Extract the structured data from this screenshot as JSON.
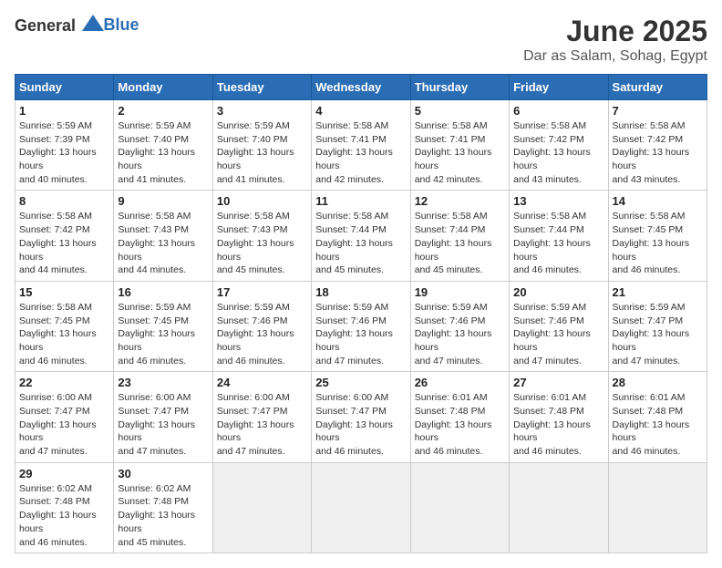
{
  "header": {
    "logo_general": "General",
    "logo_blue": "Blue",
    "month": "June 2025",
    "location": "Dar as Salam, Sohag, Egypt"
  },
  "weekdays": [
    "Sunday",
    "Monday",
    "Tuesday",
    "Wednesday",
    "Thursday",
    "Friday",
    "Saturday"
  ],
  "weeks": [
    [
      {
        "day": 1,
        "sunrise": "5:59 AM",
        "sunset": "7:39 PM",
        "daylight": "13 hours and 40 minutes"
      },
      {
        "day": 2,
        "sunrise": "5:59 AM",
        "sunset": "7:40 PM",
        "daylight": "13 hours and 41 minutes"
      },
      {
        "day": 3,
        "sunrise": "5:59 AM",
        "sunset": "7:40 PM",
        "daylight": "13 hours and 41 minutes"
      },
      {
        "day": 4,
        "sunrise": "5:58 AM",
        "sunset": "7:41 PM",
        "daylight": "13 hours and 42 minutes"
      },
      {
        "day": 5,
        "sunrise": "5:58 AM",
        "sunset": "7:41 PM",
        "daylight": "13 hours and 42 minutes"
      },
      {
        "day": 6,
        "sunrise": "5:58 AM",
        "sunset": "7:42 PM",
        "daylight": "13 hours and 43 minutes"
      },
      {
        "day": 7,
        "sunrise": "5:58 AM",
        "sunset": "7:42 PM",
        "daylight": "13 hours and 43 minutes"
      }
    ],
    [
      {
        "day": 8,
        "sunrise": "5:58 AM",
        "sunset": "7:42 PM",
        "daylight": "13 hours and 44 minutes"
      },
      {
        "day": 9,
        "sunrise": "5:58 AM",
        "sunset": "7:43 PM",
        "daylight": "13 hours and 44 minutes"
      },
      {
        "day": 10,
        "sunrise": "5:58 AM",
        "sunset": "7:43 PM",
        "daylight": "13 hours and 45 minutes"
      },
      {
        "day": 11,
        "sunrise": "5:58 AM",
        "sunset": "7:44 PM",
        "daylight": "13 hours and 45 minutes"
      },
      {
        "day": 12,
        "sunrise": "5:58 AM",
        "sunset": "7:44 PM",
        "daylight": "13 hours and 45 minutes"
      },
      {
        "day": 13,
        "sunrise": "5:58 AM",
        "sunset": "7:44 PM",
        "daylight": "13 hours and 46 minutes"
      },
      {
        "day": 14,
        "sunrise": "5:58 AM",
        "sunset": "7:45 PM",
        "daylight": "13 hours and 46 minutes"
      }
    ],
    [
      {
        "day": 15,
        "sunrise": "5:58 AM",
        "sunset": "7:45 PM",
        "daylight": "13 hours and 46 minutes"
      },
      {
        "day": 16,
        "sunrise": "5:59 AM",
        "sunset": "7:45 PM",
        "daylight": "13 hours and 46 minutes"
      },
      {
        "day": 17,
        "sunrise": "5:59 AM",
        "sunset": "7:46 PM",
        "daylight": "13 hours and 46 minutes"
      },
      {
        "day": 18,
        "sunrise": "5:59 AM",
        "sunset": "7:46 PM",
        "daylight": "13 hours and 47 minutes"
      },
      {
        "day": 19,
        "sunrise": "5:59 AM",
        "sunset": "7:46 PM",
        "daylight": "13 hours and 47 minutes"
      },
      {
        "day": 20,
        "sunrise": "5:59 AM",
        "sunset": "7:46 PM",
        "daylight": "13 hours and 47 minutes"
      },
      {
        "day": 21,
        "sunrise": "5:59 AM",
        "sunset": "7:47 PM",
        "daylight": "13 hours and 47 minutes"
      }
    ],
    [
      {
        "day": 22,
        "sunrise": "6:00 AM",
        "sunset": "7:47 PM",
        "daylight": "13 hours and 47 minutes"
      },
      {
        "day": 23,
        "sunrise": "6:00 AM",
        "sunset": "7:47 PM",
        "daylight": "13 hours and 47 minutes"
      },
      {
        "day": 24,
        "sunrise": "6:00 AM",
        "sunset": "7:47 PM",
        "daylight": "13 hours and 47 minutes"
      },
      {
        "day": 25,
        "sunrise": "6:00 AM",
        "sunset": "7:47 PM",
        "daylight": "13 hours and 46 minutes"
      },
      {
        "day": 26,
        "sunrise": "6:01 AM",
        "sunset": "7:48 PM",
        "daylight": "13 hours and 46 minutes"
      },
      {
        "day": 27,
        "sunrise": "6:01 AM",
        "sunset": "7:48 PM",
        "daylight": "13 hours and 46 minutes"
      },
      {
        "day": 28,
        "sunrise": "6:01 AM",
        "sunset": "7:48 PM",
        "daylight": "13 hours and 46 minutes"
      }
    ],
    [
      {
        "day": 29,
        "sunrise": "6:02 AM",
        "sunset": "7:48 PM",
        "daylight": "13 hours and 46 minutes"
      },
      {
        "day": 30,
        "sunrise": "6:02 AM",
        "sunset": "7:48 PM",
        "daylight": "13 hours and 45 minutes"
      },
      null,
      null,
      null,
      null,
      null
    ]
  ]
}
